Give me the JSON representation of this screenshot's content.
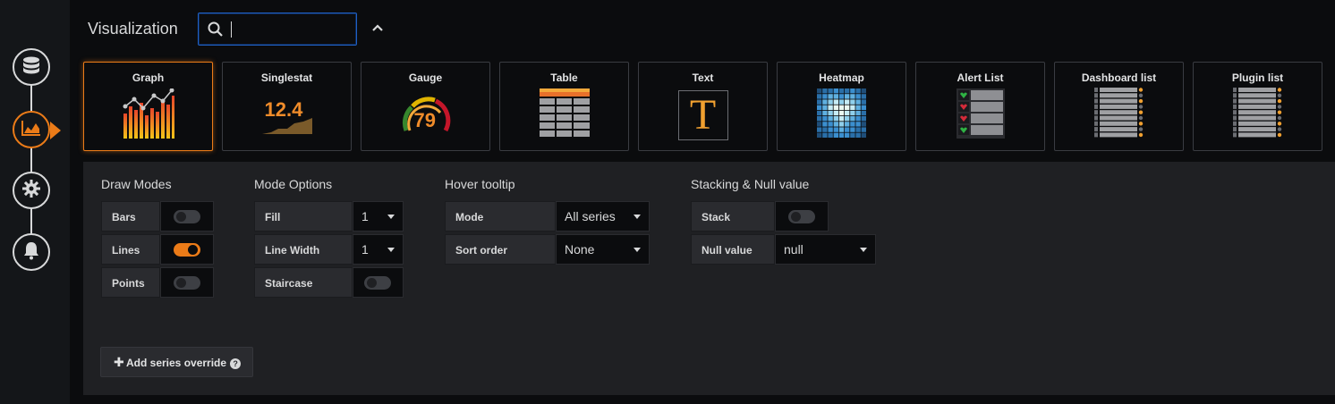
{
  "header": {
    "title": "Visualization",
    "search_value": "",
    "search_placeholder": ""
  },
  "rail": {
    "items": [
      {
        "name": "queries",
        "icon": "database-icon"
      },
      {
        "name": "visualization",
        "icon": "area-chart-icon",
        "active": true
      },
      {
        "name": "general",
        "icon": "gear-icon"
      },
      {
        "name": "alert",
        "icon": "bell-icon"
      }
    ]
  },
  "visualizations": [
    {
      "label": "Graph",
      "icon": "graph-icon",
      "selected": true
    },
    {
      "label": "Singlestat",
      "icon": "singlestat-icon",
      "value": "12.4"
    },
    {
      "label": "Gauge",
      "icon": "gauge-icon",
      "value": "79"
    },
    {
      "label": "Table",
      "icon": "table-icon"
    },
    {
      "label": "Text",
      "icon": "text-icon",
      "glyph": "T"
    },
    {
      "label": "Heatmap",
      "icon": "heatmap-icon"
    },
    {
      "label": "Alert List",
      "icon": "alert-list-icon"
    },
    {
      "label": "Dashboard list",
      "icon": "dashboard-list-icon"
    },
    {
      "label": "Plugin list",
      "icon": "plugin-list-icon"
    }
  ],
  "draw_modes": {
    "title": "Draw Modes",
    "bars_label": "Bars",
    "bars_on": false,
    "lines_label": "Lines",
    "lines_on": true,
    "points_label": "Points",
    "points_on": false
  },
  "mode_options": {
    "title": "Mode Options",
    "fill_label": "Fill",
    "fill_value": "1",
    "line_width_label": "Line Width",
    "line_width_value": "1",
    "staircase_label": "Staircase",
    "staircase_on": false
  },
  "hover_tooltip": {
    "title": "Hover tooltip",
    "mode_label": "Mode",
    "mode_value": "All series",
    "sort_label": "Sort order",
    "sort_value": "None"
  },
  "stacking": {
    "title": "Stacking & Null value",
    "stack_label": "Stack",
    "stack_on": false,
    "null_label": "Null value",
    "null_value": "null"
  },
  "actions": {
    "add_override_label": "Add series override"
  },
  "colors": {
    "accent": "#eb7b18",
    "focus": "#1f60c4",
    "panel_bg": "#1f2023",
    "page_bg": "#0b0c0e"
  }
}
